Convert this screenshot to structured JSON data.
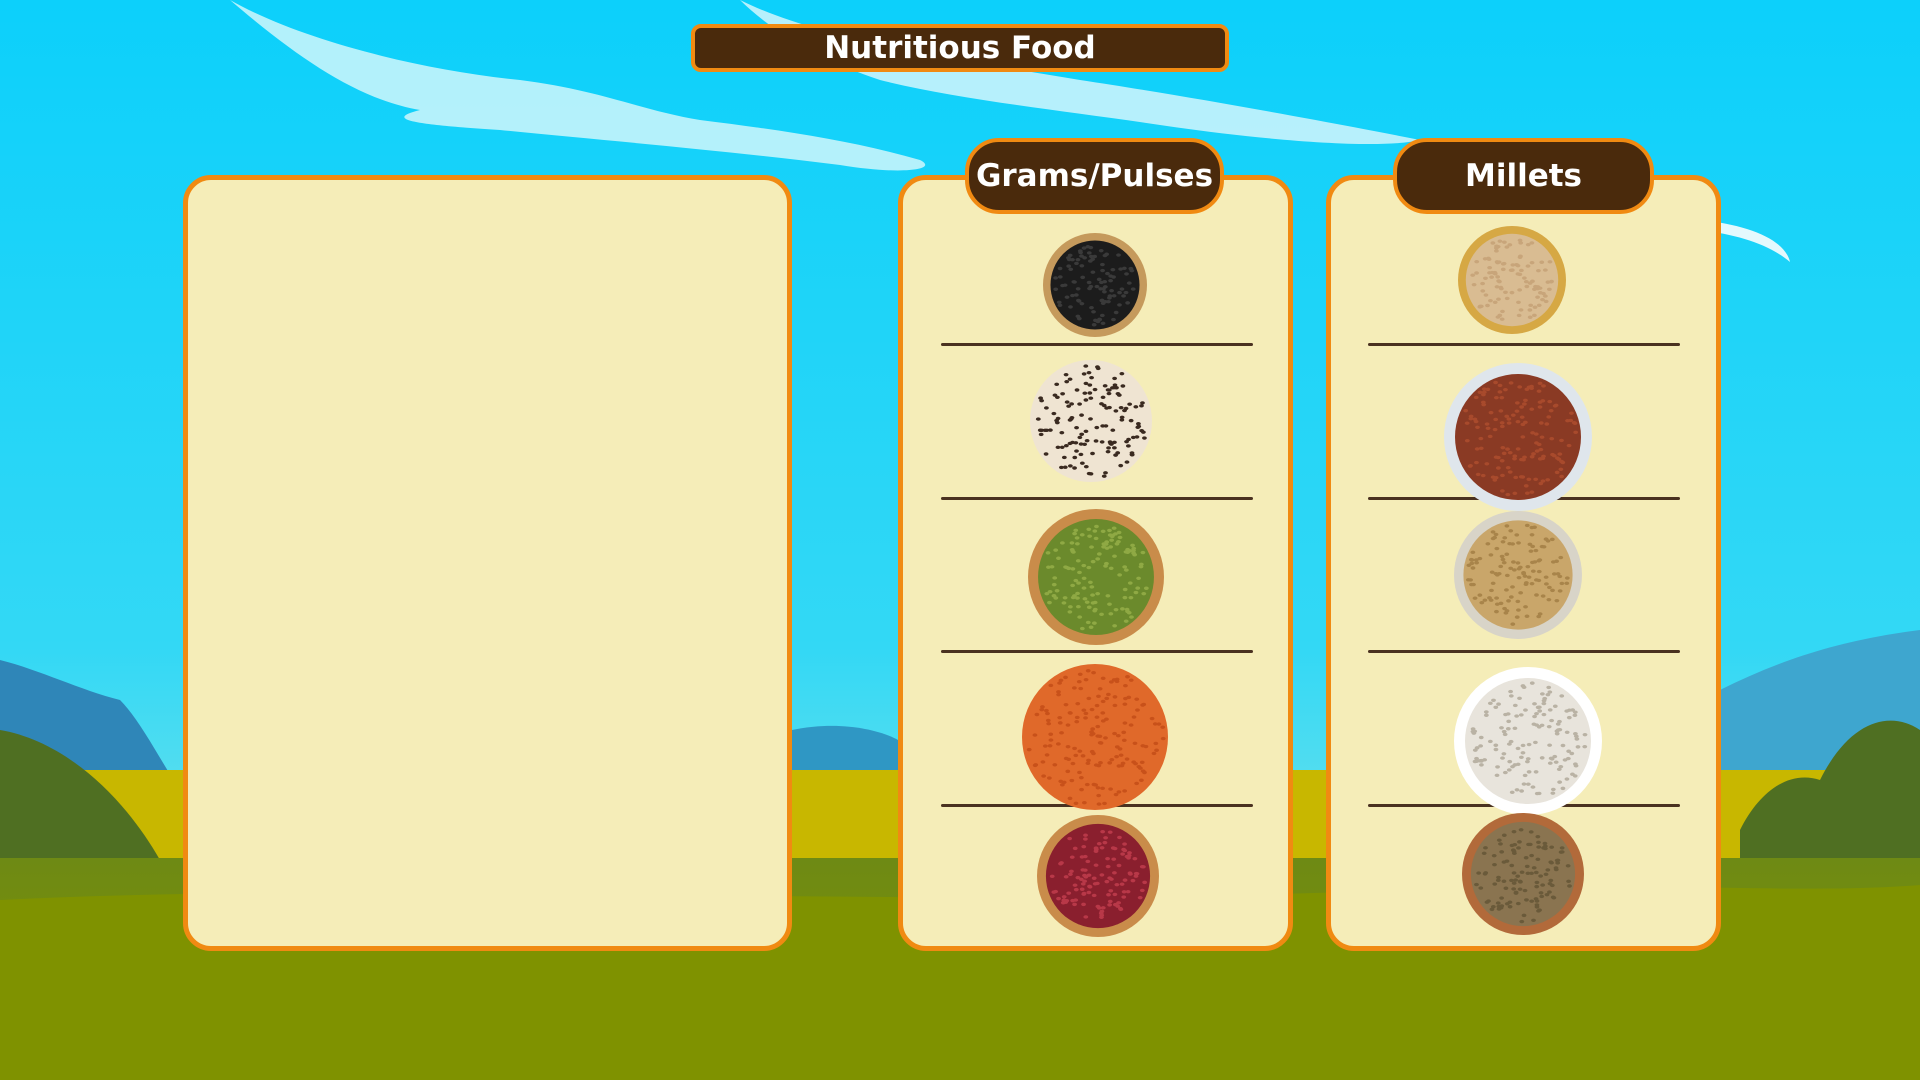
{
  "title": "Nutritious Food",
  "drop_zone": {
    "label": ""
  },
  "categories": [
    {
      "key": "pulses",
      "label": "Grams/Pulses",
      "items": [
        {
          "name": "black-gram-icon",
          "colors": {
            "rim": "#c59a5c",
            "fill": "#1c1c1c",
            "grain": "#3a3a3a"
          }
        },
        {
          "name": "black-eyed-peas-icon",
          "colors": {
            "rim": "none",
            "fill": "#efe4d2",
            "grain": "#3a2a20"
          }
        },
        {
          "name": "green-gram-icon",
          "colors": {
            "rim": "#c98c4a",
            "fill": "#6b8a2c",
            "grain": "#8fa944"
          }
        },
        {
          "name": "red-lentils-icon",
          "colors": {
            "rim": "none",
            "fill": "#e0692a",
            "grain": "#c8511a"
          }
        },
        {
          "name": "kidney-beans-icon",
          "colors": {
            "rim": "#c98c4a",
            "fill": "#8a1f2e",
            "grain": "#b83848"
          }
        }
      ]
    },
    {
      "key": "millets",
      "label": "Millets",
      "items": [
        {
          "name": "foxtail-millet-icon",
          "colors": {
            "rim": "#d6a844",
            "fill": "#d9bc92",
            "grain": "#c8a57a"
          }
        },
        {
          "name": "finger-millet-icon",
          "colors": {
            "rim": "#dfe6ec",
            "fill": "#8a3a24",
            "grain": "#a84a2c"
          }
        },
        {
          "name": "pearl-millet-icon",
          "colors": {
            "rim": "#d8d4c8",
            "fill": "#c9a66a",
            "grain": "#a8844a"
          }
        },
        {
          "name": "barnyard-millet-icon",
          "colors": {
            "rim": "#ffffff",
            "fill": "#e8e4dc",
            "grain": "#b9b2a4"
          }
        },
        {
          "name": "little-millet-icon",
          "colors": {
            "rim": "#b26a3a",
            "fill": "#8a7450",
            "grain": "#6a5a3a"
          }
        }
      ]
    }
  ],
  "colors": {
    "sky_top": "#0cd0fb",
    "sky_bottom": "#7fe5e8",
    "grass": "#7f9200",
    "grass_far": "#6f8c16",
    "panel_bg": "#f5edb8",
    "panel_border": "#f08a12",
    "banner_bg": "#4a2a0c",
    "banner_text": "#ffffff"
  }
}
